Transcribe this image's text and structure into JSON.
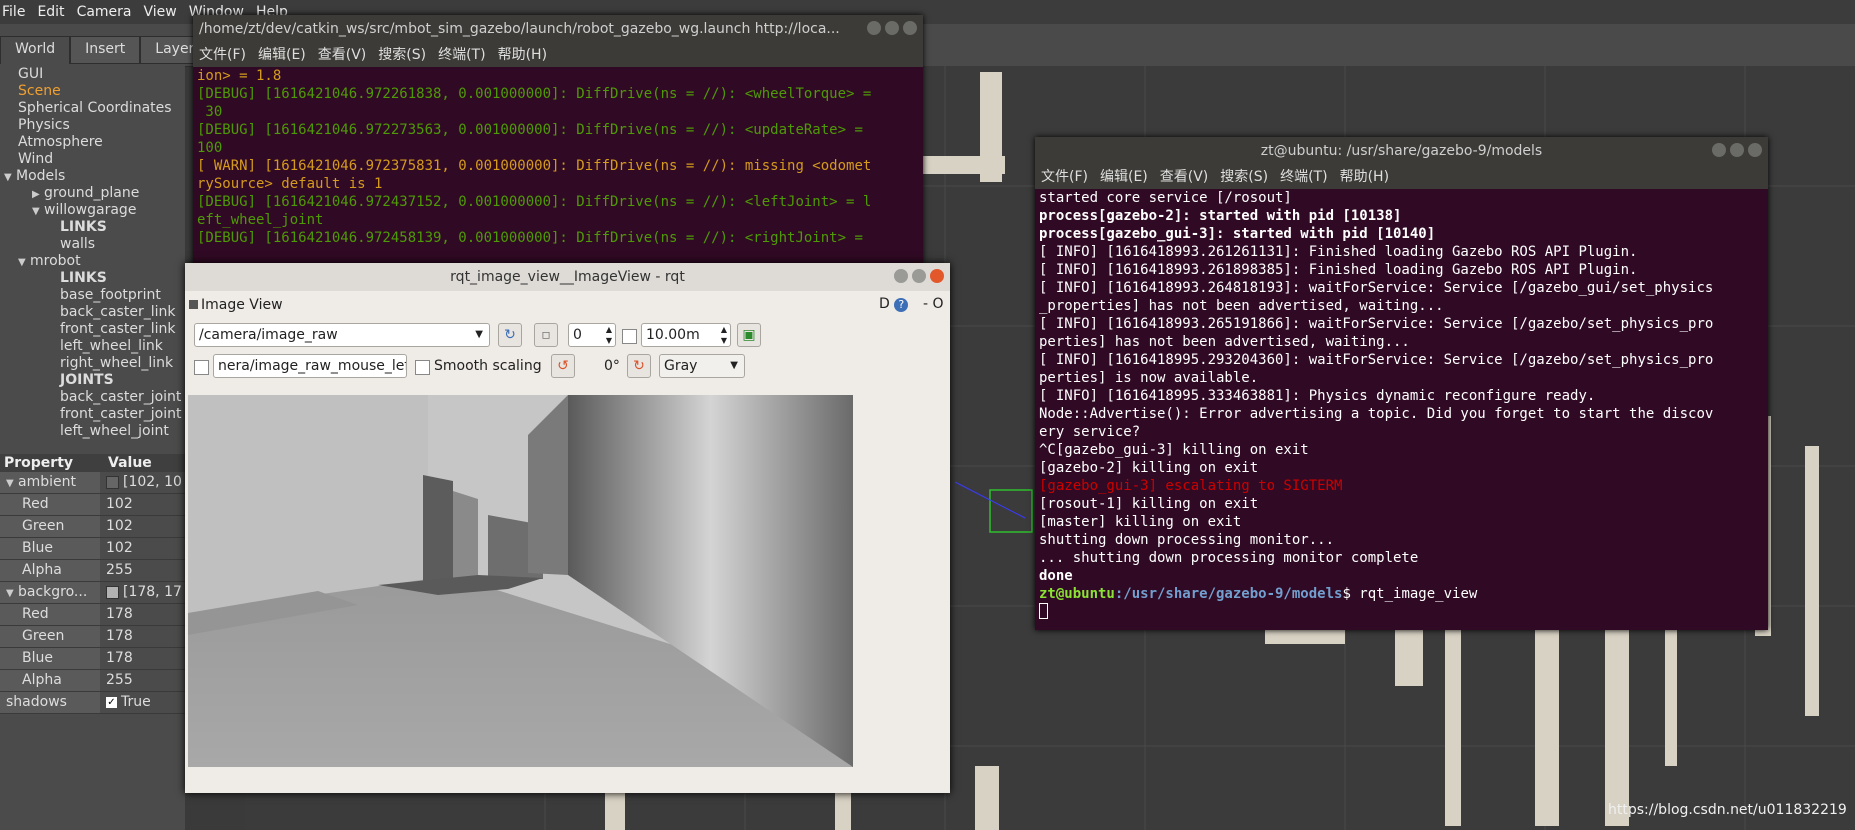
{
  "gazebo": {
    "menu": [
      "File",
      "Edit",
      "Camera",
      "View",
      "Window",
      "Help"
    ],
    "tabs": [
      "World",
      "Insert",
      "Layers"
    ],
    "tree": [
      {
        "label": "GUI",
        "indent": 1,
        "style": ""
      },
      {
        "label": "Scene",
        "indent": 1,
        "style": "orange"
      },
      {
        "label": "Spherical Coordinates",
        "indent": 1,
        "style": ""
      },
      {
        "label": "Physics",
        "indent": 1,
        "style": ""
      },
      {
        "label": "Atmosphere",
        "indent": 1,
        "style": ""
      },
      {
        "label": "Wind",
        "indent": 1,
        "style": ""
      },
      {
        "label": "Models",
        "indent": 0,
        "style": "",
        "arrow": "▼"
      },
      {
        "label": "ground_plane",
        "indent": 2,
        "style": "",
        "arrow": "▶"
      },
      {
        "label": "willowgarage",
        "indent": 2,
        "style": "",
        "arrow": "▼"
      },
      {
        "label": "LINKS",
        "indent": 4,
        "style": "bold"
      },
      {
        "label": "walls",
        "indent": 4,
        "style": ""
      },
      {
        "label": "mrobot",
        "indent": 1,
        "style": "",
        "arrow": "▼"
      },
      {
        "label": "LINKS",
        "indent": 4,
        "style": "bold"
      },
      {
        "label": "base_footprint",
        "indent": 4,
        "style": ""
      },
      {
        "label": "back_caster_link",
        "indent": 4,
        "style": ""
      },
      {
        "label": "front_caster_link",
        "indent": 4,
        "style": ""
      },
      {
        "label": "left_wheel_link",
        "indent": 4,
        "style": ""
      },
      {
        "label": "right_wheel_link",
        "indent": 4,
        "style": ""
      },
      {
        "label": "JOINTS",
        "indent": 4,
        "style": "bold"
      },
      {
        "label": "back_caster_joint",
        "indent": 4,
        "style": ""
      },
      {
        "label": "front_caster_joint",
        "indent": 4,
        "style": ""
      },
      {
        "label": "left_wheel_joint",
        "indent": 4,
        "style": ""
      }
    ],
    "prop_header": {
      "name": "Property",
      "value": "Value"
    },
    "props": [
      {
        "name": "ambient",
        "value": "[102, 10",
        "arrow": "▼",
        "swatch": "#666666"
      },
      {
        "name": "Red",
        "value": "102",
        "indent": true
      },
      {
        "name": "Green",
        "value": "102",
        "indent": true
      },
      {
        "name": "Blue",
        "value": "102",
        "indent": true
      },
      {
        "name": "Alpha",
        "value": "255",
        "indent": true
      },
      {
        "name": "backgro...",
        "value": "[178, 17",
        "arrow": "▼",
        "swatch": "#b2b2b2"
      },
      {
        "name": "Red",
        "value": "178",
        "indent": true
      },
      {
        "name": "Green",
        "value": "178",
        "indent": true
      },
      {
        "name": "Blue",
        "value": "178",
        "indent": true
      },
      {
        "name": "Alpha",
        "value": "255",
        "indent": true
      },
      {
        "name": "shadows",
        "value": "True",
        "check": true
      }
    ]
  },
  "term1": {
    "title": "/home/zt/dev/catkin_ws/src/mbot_sim_gazebo/launch/robot_gazebo_wg.launch http://loca...",
    "menu": [
      "文件(F)",
      "编辑(E)",
      "查看(V)",
      "搜索(S)",
      "终端(T)",
      "帮助(H)"
    ],
    "lines": [
      {
        "t": "ion> = 1.8",
        "c": "y"
      },
      {
        "t": "[DEBUG] [1616421046.972261838, 0.001000000]: DiffDrive(ns = //): <wheelTorque> =",
        "c": "g"
      },
      {
        "t": " 30",
        "c": "g"
      },
      {
        "t": "[DEBUG] [1616421046.972273563, 0.001000000]: DiffDrive(ns = //): <updateRate> =",
        "c": "g"
      },
      {
        "t": "100",
        "c": "g"
      },
      {
        "t": "[ WARN] [1616421046.972375831, 0.001000000]: DiffDrive(ns = //): missing <odomet",
        "c": "y"
      },
      {
        "t": "rySource> default is 1",
        "c": "y"
      },
      {
        "t": "[DEBUG] [1616421046.972437152, 0.001000000]: DiffDrive(ns = //): <leftJoint> = l",
        "c": "g"
      },
      {
        "t": "eft_wheel_joint",
        "c": "g"
      },
      {
        "t": "[DEBUG] [1616421046.972458139, 0.001000000]: DiffDrive(ns = //): <rightJoint> =",
        "c": "g"
      }
    ]
  },
  "term2": {
    "title": "zt@ubuntu: /usr/share/gazebo-9/models",
    "menu": [
      "文件(F)",
      "编辑(E)",
      "查看(V)",
      "搜索(S)",
      "终端(T)",
      "帮助(H)"
    ],
    "lines": [
      {
        "t": "started core service [/rosout]",
        "c": "w"
      },
      {
        "t": "process[gazebo-2]: started with pid [10138]",
        "c": "b"
      },
      {
        "t": "process[gazebo_gui-3]: started with pid [10140]",
        "c": "b"
      },
      {
        "t": "[ INFO] [1616418993.261261131]: Finished loading Gazebo ROS API Plugin.",
        "c": "w"
      },
      {
        "t": "[ INFO] [1616418993.261898385]: Finished loading Gazebo ROS API Plugin.",
        "c": "w"
      },
      {
        "t": "[ INFO] [1616418993.264818193]: waitForService: Service [/gazebo_gui/set_physics",
        "c": "w"
      },
      {
        "t": "_properties] has not been advertised, waiting...",
        "c": "w"
      },
      {
        "t": "[ INFO] [1616418993.265191866]: waitForService: Service [/gazebo/set_physics_pro",
        "c": "w"
      },
      {
        "t": "perties] has not been advertised, waiting...",
        "c": "w"
      },
      {
        "t": "[ INFO] [1616418995.293204360]: waitForService: Service [/gazebo/set_physics_pro",
        "c": "w"
      },
      {
        "t": "perties] is now available.",
        "c": "w"
      },
      {
        "t": "[ INFO] [1616418995.333463881]: Physics dynamic reconfigure ready.",
        "c": "w"
      },
      {
        "t": "Node::Advertise(): Error advertising a topic. Did you forget to start the discov",
        "c": "w"
      },
      {
        "t": "ery service?",
        "c": "w"
      },
      {
        "t": "^C[gazebo_gui-3] killing on exit",
        "c": "w"
      },
      {
        "t": "[gazebo-2] killing on exit",
        "c": "w"
      },
      {
        "t": "[gazebo_gui-3] escalating to SIGTERM",
        "c": "r"
      },
      {
        "t": "[rosout-1] killing on exit",
        "c": "w"
      },
      {
        "t": "[master] killing on exit",
        "c": "w"
      },
      {
        "t": "shutting down processing monitor...",
        "c": "w"
      },
      {
        "t": "... shutting down processing monitor complete",
        "c": "w"
      },
      {
        "t": "done",
        "c": "b"
      }
    ],
    "prompt_user": "zt@ubuntu",
    "prompt_path": ":/usr/share/gazebo-9/models",
    "prompt_cmd": "$ rqt_image_view"
  },
  "rqt": {
    "title": "rqt_image_view__ImageView - rqt",
    "panel_label": "Image View",
    "topic": "/camera/image_raw",
    "spin_value": "0",
    "distance": "10.00m",
    "mouse_topic": "nera/image_raw_mouse_left",
    "smooth_label": "Smooth scaling",
    "rotation": "0°",
    "color_mode": "Gray",
    "corner": "D",
    "corner2": "- O"
  },
  "watermark": "https://blog.csdn.net/u011832219"
}
